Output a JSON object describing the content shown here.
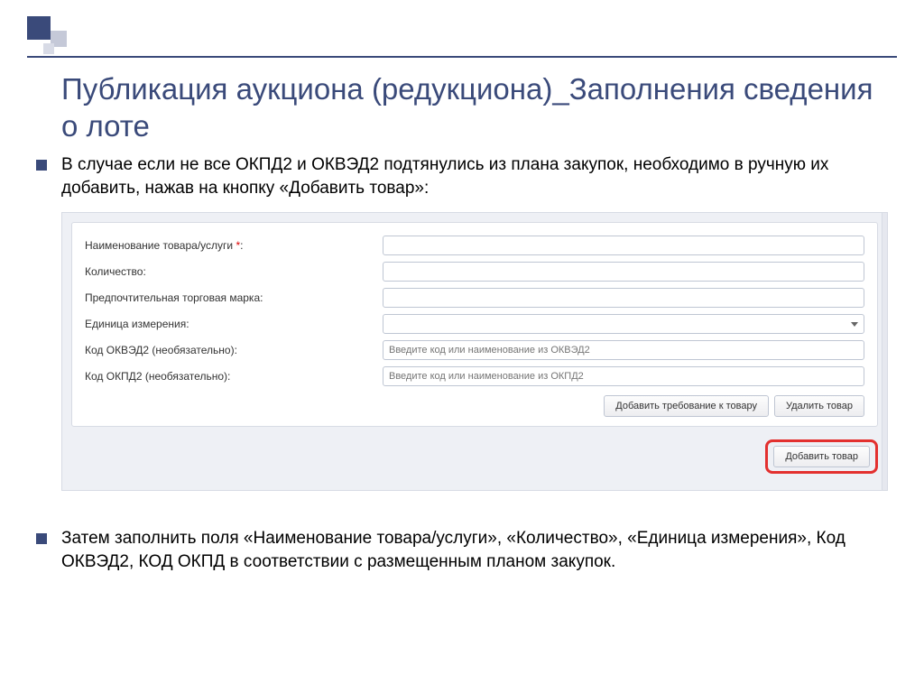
{
  "title": "Публикация аукциона (редукциона)_Заполнения сведения о лоте",
  "bullets": {
    "b1": "В случае если не все ОКПД2 и ОКВЭД2 подтянулись из плана закупок, необходимо в ручную их добавить, нажав на кнопку «Добавить товар»:",
    "b2": "Затем заполнить поля «Наименование товара/услуги», «Количество», «Единица измерения», Код ОКВЭД2, КОД ОКПД в соответствии с размещенным планом закупок."
  },
  "form": {
    "name_label": "Наименование товара/услуги",
    "name_req": "*",
    "qty_label": "Количество:",
    "brand_label": "Предпочтительная торговая марка:",
    "unit_label": "Единица измерения:",
    "okved_label": "Код ОКВЭД2 (необязательно):",
    "okved_placeholder": "Введите код или наименование из ОКВЭД2",
    "okpd_label": "Код ОКПД2 (необязательно):",
    "okpd_placeholder": "Введите код или наименование из ОКПД2"
  },
  "buttons": {
    "add_requirement": "Добавить требование к товару",
    "delete_product": "Удалить товар",
    "add_product": "Добавить товар"
  }
}
